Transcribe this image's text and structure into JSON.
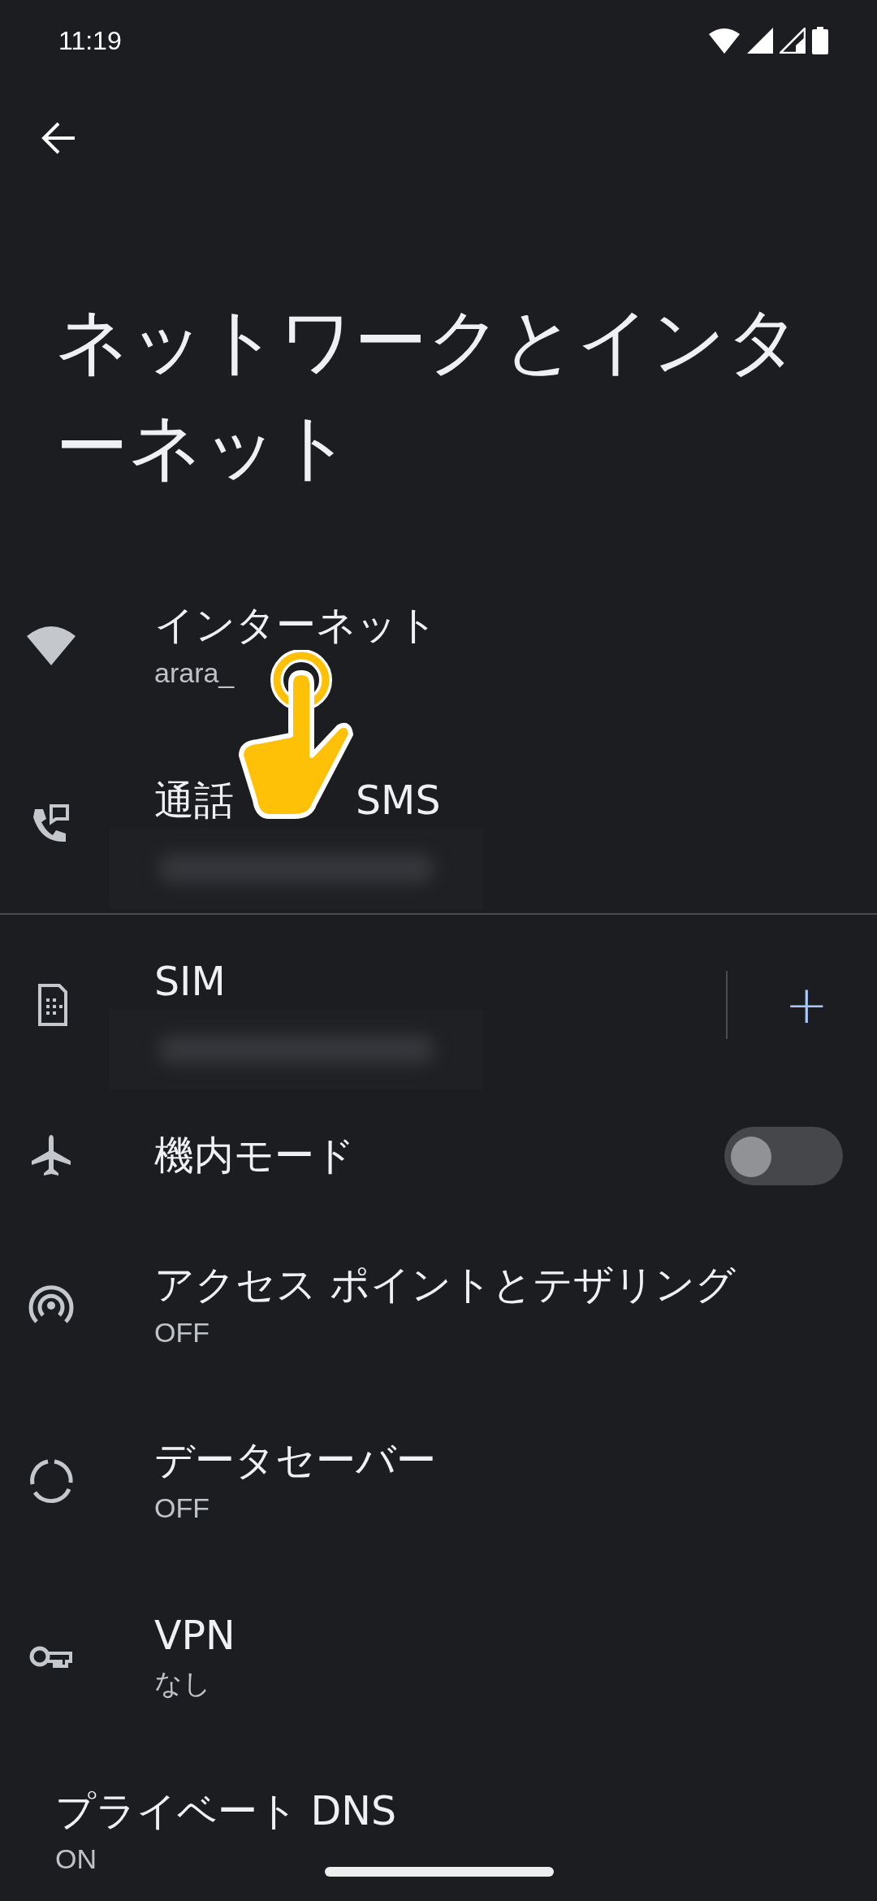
{
  "status_bar": {
    "time": "11:19"
  },
  "title": "ネットワークとインターネット",
  "items": [
    {
      "kind": "link",
      "title": "インターネット",
      "subtitle": "arara_",
      "redacted": false
    },
    {
      "kind": "link",
      "title": "通話",
      "title_tail": "SMS",
      "redacted": true,
      "divider_after": true
    },
    {
      "kind": "sim",
      "title": "SIM",
      "redacted": true,
      "action": "+"
    },
    {
      "kind": "toggle",
      "title": "機内モード",
      "on": false
    },
    {
      "kind": "link",
      "title": "アクセス ポイントとテザリング",
      "subtitle": "OFF"
    },
    {
      "kind": "link",
      "title": "データセーバー",
      "subtitle": "OFF"
    },
    {
      "kind": "link",
      "title": "VPN",
      "subtitle": "なし"
    },
    {
      "kind": "plain",
      "title": "プライベート DNS",
      "subtitle": "ON"
    }
  ]
}
